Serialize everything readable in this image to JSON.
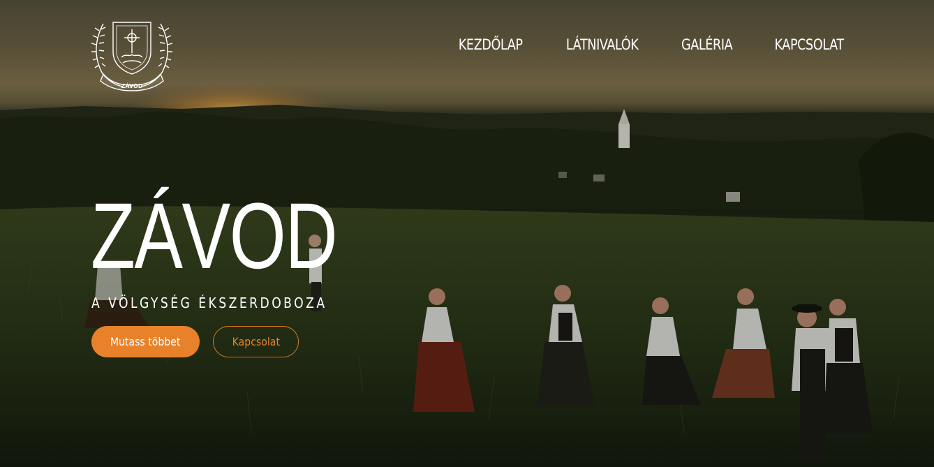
{
  "brand": {
    "logo_text": "ZÁVOD"
  },
  "nav": {
    "items": [
      {
        "label": "KEZDŐLAP"
      },
      {
        "label": "LÁTNIVALÓK"
      },
      {
        "label": "GALÉRIA"
      },
      {
        "label": "KAPCSOLAT"
      }
    ]
  },
  "hero": {
    "title": "ZÁVOD",
    "subtitle": "A VÖLGYSÉG ÉKSZERDOBOZA",
    "primary_button": "Mutass többet",
    "secondary_button": "Kapcsolat"
  },
  "colors": {
    "accent": "#e8822a",
    "text": "#ffffff"
  }
}
